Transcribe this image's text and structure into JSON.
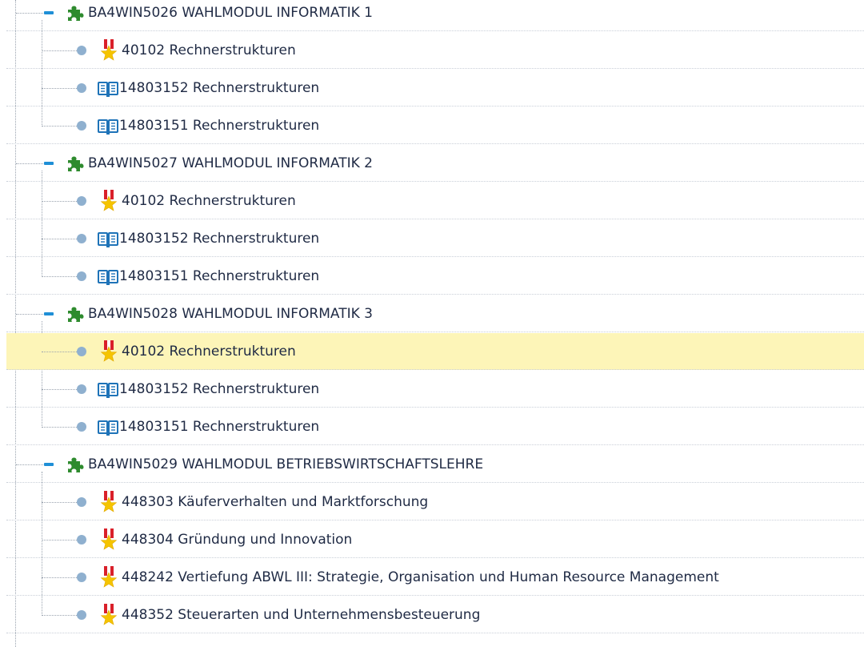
{
  "tree": {
    "groups": [
      {
        "label": "BA4WIN5026 WAHLMODUL INFORMATIK 1",
        "items": [
          {
            "type": "exam",
            "label": "40102 Rechnerstrukturen"
          },
          {
            "type": "course",
            "label": "14803152 Rechnerstrukturen"
          },
          {
            "type": "course",
            "label": "14803151 Rechnerstrukturen"
          }
        ]
      },
      {
        "label": "BA4WIN5027 WAHLMODUL INFORMATIK 2",
        "items": [
          {
            "type": "exam",
            "label": "40102 Rechnerstrukturen"
          },
          {
            "type": "course",
            "label": "14803152 Rechnerstrukturen"
          },
          {
            "type": "course",
            "label": "14803151 Rechnerstrukturen"
          }
        ]
      },
      {
        "label": "BA4WIN5028 WAHLMODUL INFORMATIK 3",
        "items": [
          {
            "type": "exam",
            "label": "40102 Rechnerstrukturen",
            "selected": true
          },
          {
            "type": "course",
            "label": "14803152 Rechnerstrukturen"
          },
          {
            "type": "course",
            "label": "14803151 Rechnerstrukturen"
          }
        ]
      },
      {
        "label": "BA4WIN5029 WAHLMODUL BETRIEBSWIRTSCHAFTSLEHRE",
        "items": [
          {
            "type": "exam",
            "label": "448303 Käuferverhalten und Marktforschung"
          },
          {
            "type": "exam",
            "label": "448304 Gründung und Innovation"
          },
          {
            "type": "exam",
            "label": "448242 Vertiefung ABWL III: Strategie, Organisation und Human Resource Management"
          },
          {
            "type": "exam",
            "label": "448352 Steuerarten und Unternehmensbesteuerung"
          }
        ]
      }
    ],
    "icons": {
      "group": "puzzle-piece-icon",
      "exam": "medal-icon",
      "course": "book-icon"
    },
    "colors": {
      "selected_row": "#fdf5b8",
      "collapse_button": "#1f8fd6",
      "leaf_dot": "#8fb0cf",
      "puzzle": "#2e8b2e",
      "medal_ribbon": "#d9202a",
      "medal_star": "#f5c400",
      "book": "#1e73b8",
      "text": "#1f2a44"
    }
  }
}
